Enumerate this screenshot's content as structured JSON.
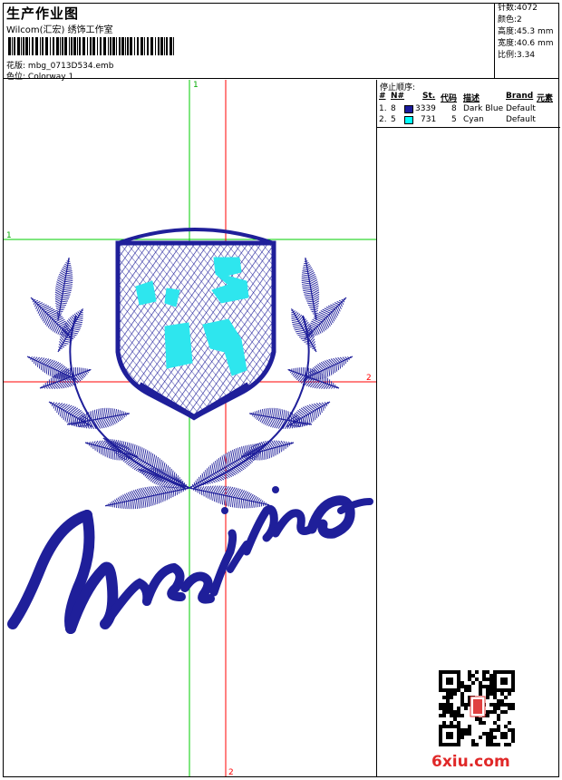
{
  "header": {
    "title": "生产作业图",
    "company": "Wilcom(汇宏) 绣饰工作室",
    "design_file_label": "花版:",
    "design_file": "mbg_0713D534.emb",
    "colorway_label": "色位:",
    "colorway": "Colorway 1"
  },
  "stats": [
    {
      "label": "针数:",
      "value": "4072"
    },
    {
      "label": "颜色:",
      "value": "2"
    },
    {
      "label": "高度:",
      "value": "45.3 mm"
    },
    {
      "label": "宽度:",
      "value": "40.6 mm"
    },
    {
      "label": "比例:",
      "value": "3.34"
    }
  ],
  "guides": {
    "green_top_label": "1",
    "green_left_label": "1",
    "red_right_label": "2",
    "red_bottom_label": "2"
  },
  "stop_sequence": {
    "title": "停止顺序:",
    "columns": [
      "#",
      "N#",
      "St.",
      "代码",
      "描述",
      "Brand",
      "元素"
    ],
    "rows": [
      {
        "index": "1.",
        "needle": "8",
        "stitches": "3339",
        "code": "8",
        "description": "Dark Blue",
        "brand": "Default",
        "color": "#1a1a9c"
      },
      {
        "index": "2.",
        "needle": "5",
        "stitches": "731",
        "code": "5",
        "description": "Cyan",
        "brand": "Default",
        "color": "#00ffff"
      }
    ]
  },
  "watermark": "6xiu.com",
  "colors": {
    "thread_dark_blue": "#1f1f9a",
    "thread_cyan": "#2ee6ee",
    "guide_green": "#00cc00",
    "guide_red": "#ff0000"
  }
}
